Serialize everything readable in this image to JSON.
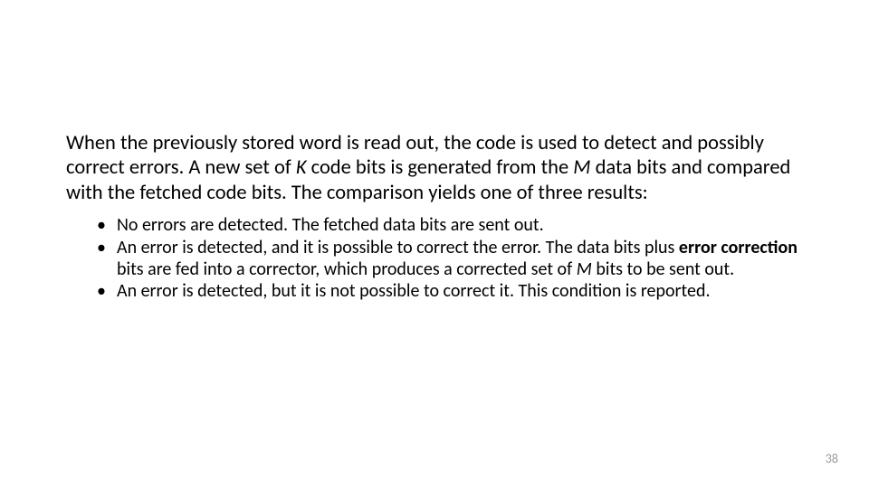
{
  "slide": {
    "intro": {
      "pre_k": "When the previously stored word is read out, the code is used to detect and possibly correct errors. A new set of ",
      "k": "K",
      "mid": " code bits is generated from the ",
      "m": "M",
      "post_m": " data bits and compared with the fetched code bits. The comparison yields one of three results:"
    },
    "bullets": [
      {
        "text": "No errors are detected. The fetched data bits are sent out."
      },
      {
        "pre": "An error is detected, and it is possible to correct the error. The data bits plus ",
        "bold": "error correction",
        "mid": " bits are fed into a corrector, which produces a corrected set of ",
        "m": "M",
        "post": " bits to be sent out."
      },
      {
        "text": "An error is detected, but it is not possible to correct it. This condition is reported."
      }
    ],
    "page_number": "38"
  }
}
